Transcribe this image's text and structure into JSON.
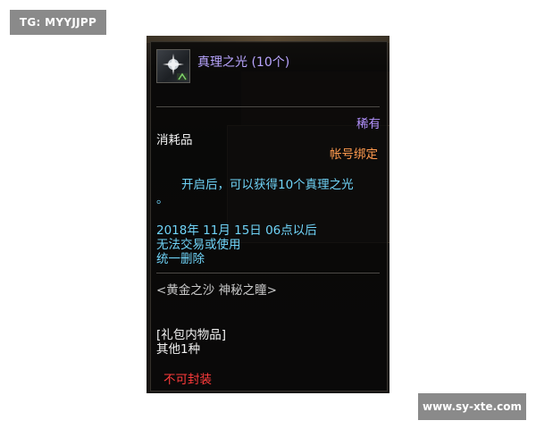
{
  "watermarks": {
    "top_left": "TG: MYYJJPP",
    "bottom_right": "www.sy-xte.com"
  },
  "item": {
    "icon": "light-crystal-icon",
    "name": "真理之光 (10个)",
    "rarity": "稀有",
    "category": "消耗品",
    "binding": "帐号绑定",
    "description_line1": "开启后，可以获得10个真理之光",
    "description_line2": "。",
    "date_line": "2018年 11月 15日 06点以后",
    "restriction_line1": "无法交易或使用",
    "restriction_line2": "统一删除",
    "source": "<黄金之沙 神秘之瞳>",
    "package_header": "[礼包内物品]",
    "package_other": "其他1种",
    "seal_status": "不可封装"
  },
  "colors": {
    "title": "#b9a5ff",
    "rarity": "#b392ff",
    "binding": "#ff9a4e",
    "description": "#6fd3f7",
    "seal_status": "#ff3b3b"
  }
}
